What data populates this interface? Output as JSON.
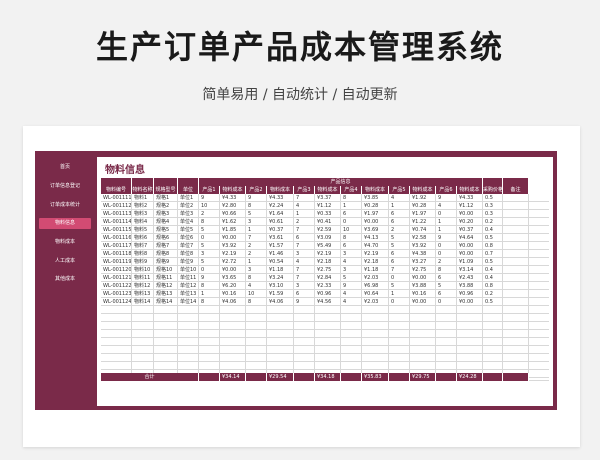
{
  "page": {
    "title": "生产订单产品成本管理系统",
    "subtitle": "简单易用 / 自动统计 / 自动更新"
  },
  "sidebar": {
    "items": [
      {
        "label": "首页",
        "active": false
      },
      {
        "label": "订单信息登记",
        "active": false
      },
      {
        "label": "订单成本统计",
        "active": false
      },
      {
        "label": "物料信息",
        "active": true
      },
      {
        "label": "物料成本",
        "active": false
      },
      {
        "label": "人工成本",
        "active": false
      },
      {
        "label": "其他成本",
        "active": false
      }
    ]
  },
  "main": {
    "title": "物料信息"
  },
  "table": {
    "group_header": "产品信息",
    "columns": [
      "物料编号",
      "物料名称",
      "规格型号",
      "单位",
      "产品1",
      "物料成本",
      "产品2",
      "物料成本",
      "产品3",
      "物料成本",
      "产品4",
      "物料成本",
      "产品5",
      "物料成本",
      "产品6",
      "物料成本",
      "采购价格",
      "备注"
    ],
    "rows": [
      [
        "WL-001111",
        "物料1",
        "规格1",
        "单位1",
        "9",
        "¥4.33",
        "9",
        "¥4.33",
        "7",
        "¥3.37",
        "8",
        "¥3.85",
        "4",
        "¥1.92",
        "9",
        "¥4.33",
        "0.5",
        ""
      ],
      [
        "WL-001112",
        "物料2",
        "规格2",
        "单位2",
        "10",
        "¥2.80",
        "8",
        "¥2.24",
        "4",
        "¥1.12",
        "1",
        "¥0.28",
        "1",
        "¥0.28",
        "4",
        "¥1.12",
        "0.3",
        ""
      ],
      [
        "WL-001113",
        "物料3",
        "规格3",
        "单位3",
        "2",
        "¥0.66",
        "5",
        "¥1.64",
        "1",
        "¥0.33",
        "6",
        "¥1.97",
        "6",
        "¥1.97",
        "0",
        "¥0.00",
        "0.3",
        ""
      ],
      [
        "WL-001114",
        "物料4",
        "规格4",
        "单位4",
        "8",
        "¥1.62",
        "3",
        "¥0.61",
        "2",
        "¥0.41",
        "0",
        "¥0.00",
        "6",
        "¥1.22",
        "1",
        "¥0.20",
        "0.2",
        ""
      ],
      [
        "WL-001115",
        "物料5",
        "规格5",
        "单位5",
        "5",
        "¥1.85",
        "1",
        "¥0.37",
        "7",
        "¥2.59",
        "10",
        "¥3.69",
        "2",
        "¥0.74",
        "1",
        "¥0.37",
        "0.4",
        ""
      ],
      [
        "WL-001116",
        "物料6",
        "规格6",
        "单位6",
        "0",
        "¥0.00",
        "7",
        "¥3.61",
        "6",
        "¥3.09",
        "8",
        "¥4.13",
        "5",
        "¥2.58",
        "9",
        "¥4.64",
        "0.5",
        ""
      ],
      [
        "WL-001117",
        "物料7",
        "规格7",
        "单位7",
        "5",
        "¥3.92",
        "2",
        "¥1.57",
        "7",
        "¥5.49",
        "6",
        "¥4.70",
        "5",
        "¥3.92",
        "0",
        "¥0.00",
        "0.8",
        ""
      ],
      [
        "WL-001118",
        "物料8",
        "规格8",
        "单位8",
        "3",
        "¥2.19",
        "2",
        "¥1.46",
        "3",
        "¥2.19",
        "3",
        "¥2.19",
        "6",
        "¥4.38",
        "0",
        "¥0.00",
        "0.7",
        ""
      ],
      [
        "WL-001119",
        "物料9",
        "规格9",
        "单位9",
        "5",
        "¥2.72",
        "1",
        "¥0.54",
        "4",
        "¥2.18",
        "4",
        "¥2.18",
        "6",
        "¥3.27",
        "2",
        "¥1.09",
        "0.5",
        ""
      ],
      [
        "WL-001120",
        "物料10",
        "规格10",
        "单位10",
        "0",
        "¥0.00",
        "3",
        "¥1.18",
        "7",
        "¥2.75",
        "3",
        "¥1.18",
        "7",
        "¥2.75",
        "8",
        "¥3.14",
        "0.4",
        ""
      ],
      [
        "WL-001121",
        "物料11",
        "规格11",
        "单位11",
        "9",
        "¥3.65",
        "8",
        "¥3.24",
        "7",
        "¥2.84",
        "5",
        "¥2.03",
        "0",
        "¥0.00",
        "6",
        "¥2.43",
        "0.4",
        ""
      ],
      [
        "WL-001122",
        "物料12",
        "规格12",
        "单位12",
        "8",
        "¥6.20",
        "4",
        "¥3.10",
        "3",
        "¥2.33",
        "9",
        "¥6.98",
        "5",
        "¥3.88",
        "5",
        "¥3.88",
        "0.8",
        ""
      ],
      [
        "WL-001123",
        "物料13",
        "规格13",
        "单位13",
        "1",
        "¥0.16",
        "10",
        "¥1.59",
        "6",
        "¥0.96",
        "4",
        "¥0.64",
        "1",
        "¥0.16",
        "6",
        "¥0.96",
        "0.2",
        ""
      ],
      [
        "WL-001124",
        "物料14",
        "规格14",
        "单位14",
        "8",
        "¥4.06",
        "8",
        "¥4.06",
        "9",
        "¥4.56",
        "4",
        "¥2.03",
        "0",
        "¥0.00",
        "0",
        "¥0.00",
        "0.5",
        ""
      ]
    ],
    "footer": {
      "label": "合计",
      "totals": [
        "¥34.14",
        "¥29.54",
        "¥34.18",
        "¥35.83",
        "¥29.75",
        "¥24.28"
      ]
    }
  }
}
